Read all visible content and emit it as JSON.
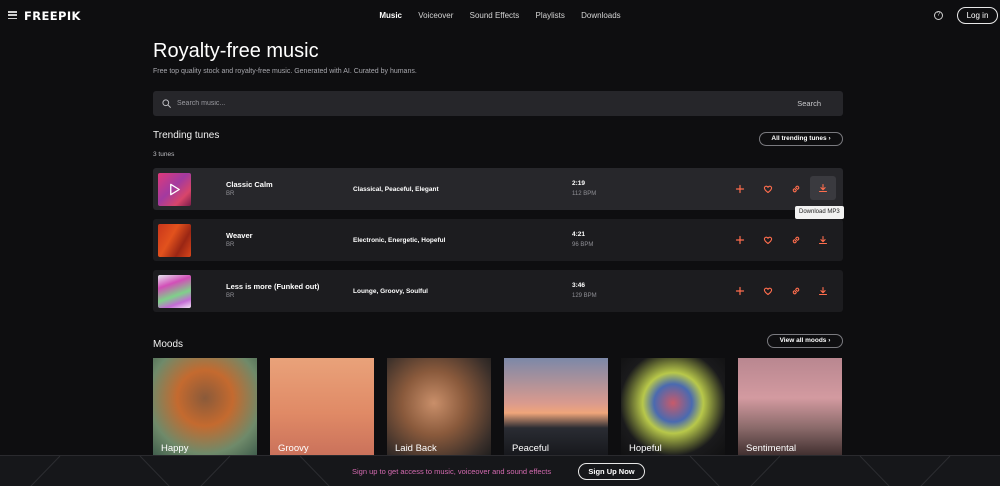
{
  "header": {
    "logo": "FREEPIK",
    "nav": [
      {
        "label": "Music",
        "active": true
      },
      {
        "label": "Voiceover",
        "active": false
      },
      {
        "label": "Sound Effects",
        "active": false
      },
      {
        "label": "Playlists",
        "active": false
      },
      {
        "label": "Downloads",
        "active": false
      }
    ],
    "help_icon": "?",
    "login_label": "Log in"
  },
  "hero": {
    "title": "Royalty-free music",
    "subtitle": "Free top quality stock and royalty-free music. Generated with AI. Curated by humans.",
    "search_placeholder": "Search music...",
    "search_button": "Search"
  },
  "trending": {
    "title": "Trending tunes",
    "all_label": "All trending tunes",
    "count_label": "3 tunes",
    "tracks": [
      {
        "title": "Classic Calm",
        "artist": "BR",
        "tags": "Classical, Peaceful, Elegant",
        "duration": "2:19",
        "bpm": "112 BPM"
      },
      {
        "title": "Weaver",
        "artist": "BR",
        "tags": "Electronic, Energetic, Hopeful",
        "duration": "4:21",
        "bpm": "96 BPM"
      },
      {
        "title": "Less is more (Funked out)",
        "artist": "BR",
        "tags": "Lounge, Groovy, Soulful",
        "duration": "3:46",
        "bpm": "129 BPM"
      }
    ],
    "tooltip": "Download MP3"
  },
  "moods": {
    "title": "Moods",
    "all_label": "View all moods",
    "items": [
      {
        "label": "Happy"
      },
      {
        "label": "Groovy"
      },
      {
        "label": "Laid Back"
      },
      {
        "label": "Peaceful"
      },
      {
        "label": "Hopeful"
      },
      {
        "label": "Sentimental"
      }
    ]
  },
  "banner": {
    "text": "Sign up to get access to music, voiceover and sound effects",
    "cta": "Sign Up Now"
  },
  "colors": {
    "background": "#0e0e10",
    "row": "#1c1c1f",
    "accent": "#ff6d4d",
    "banner_text": "#d46ab0"
  },
  "icons": {
    "menu": "menu-icon",
    "search": "search-icon",
    "play": "play-icon",
    "add": "plus-icon",
    "favorite": "heart-icon",
    "link": "link-icon",
    "download": "download-icon",
    "chevron": "chevron-right-icon"
  }
}
